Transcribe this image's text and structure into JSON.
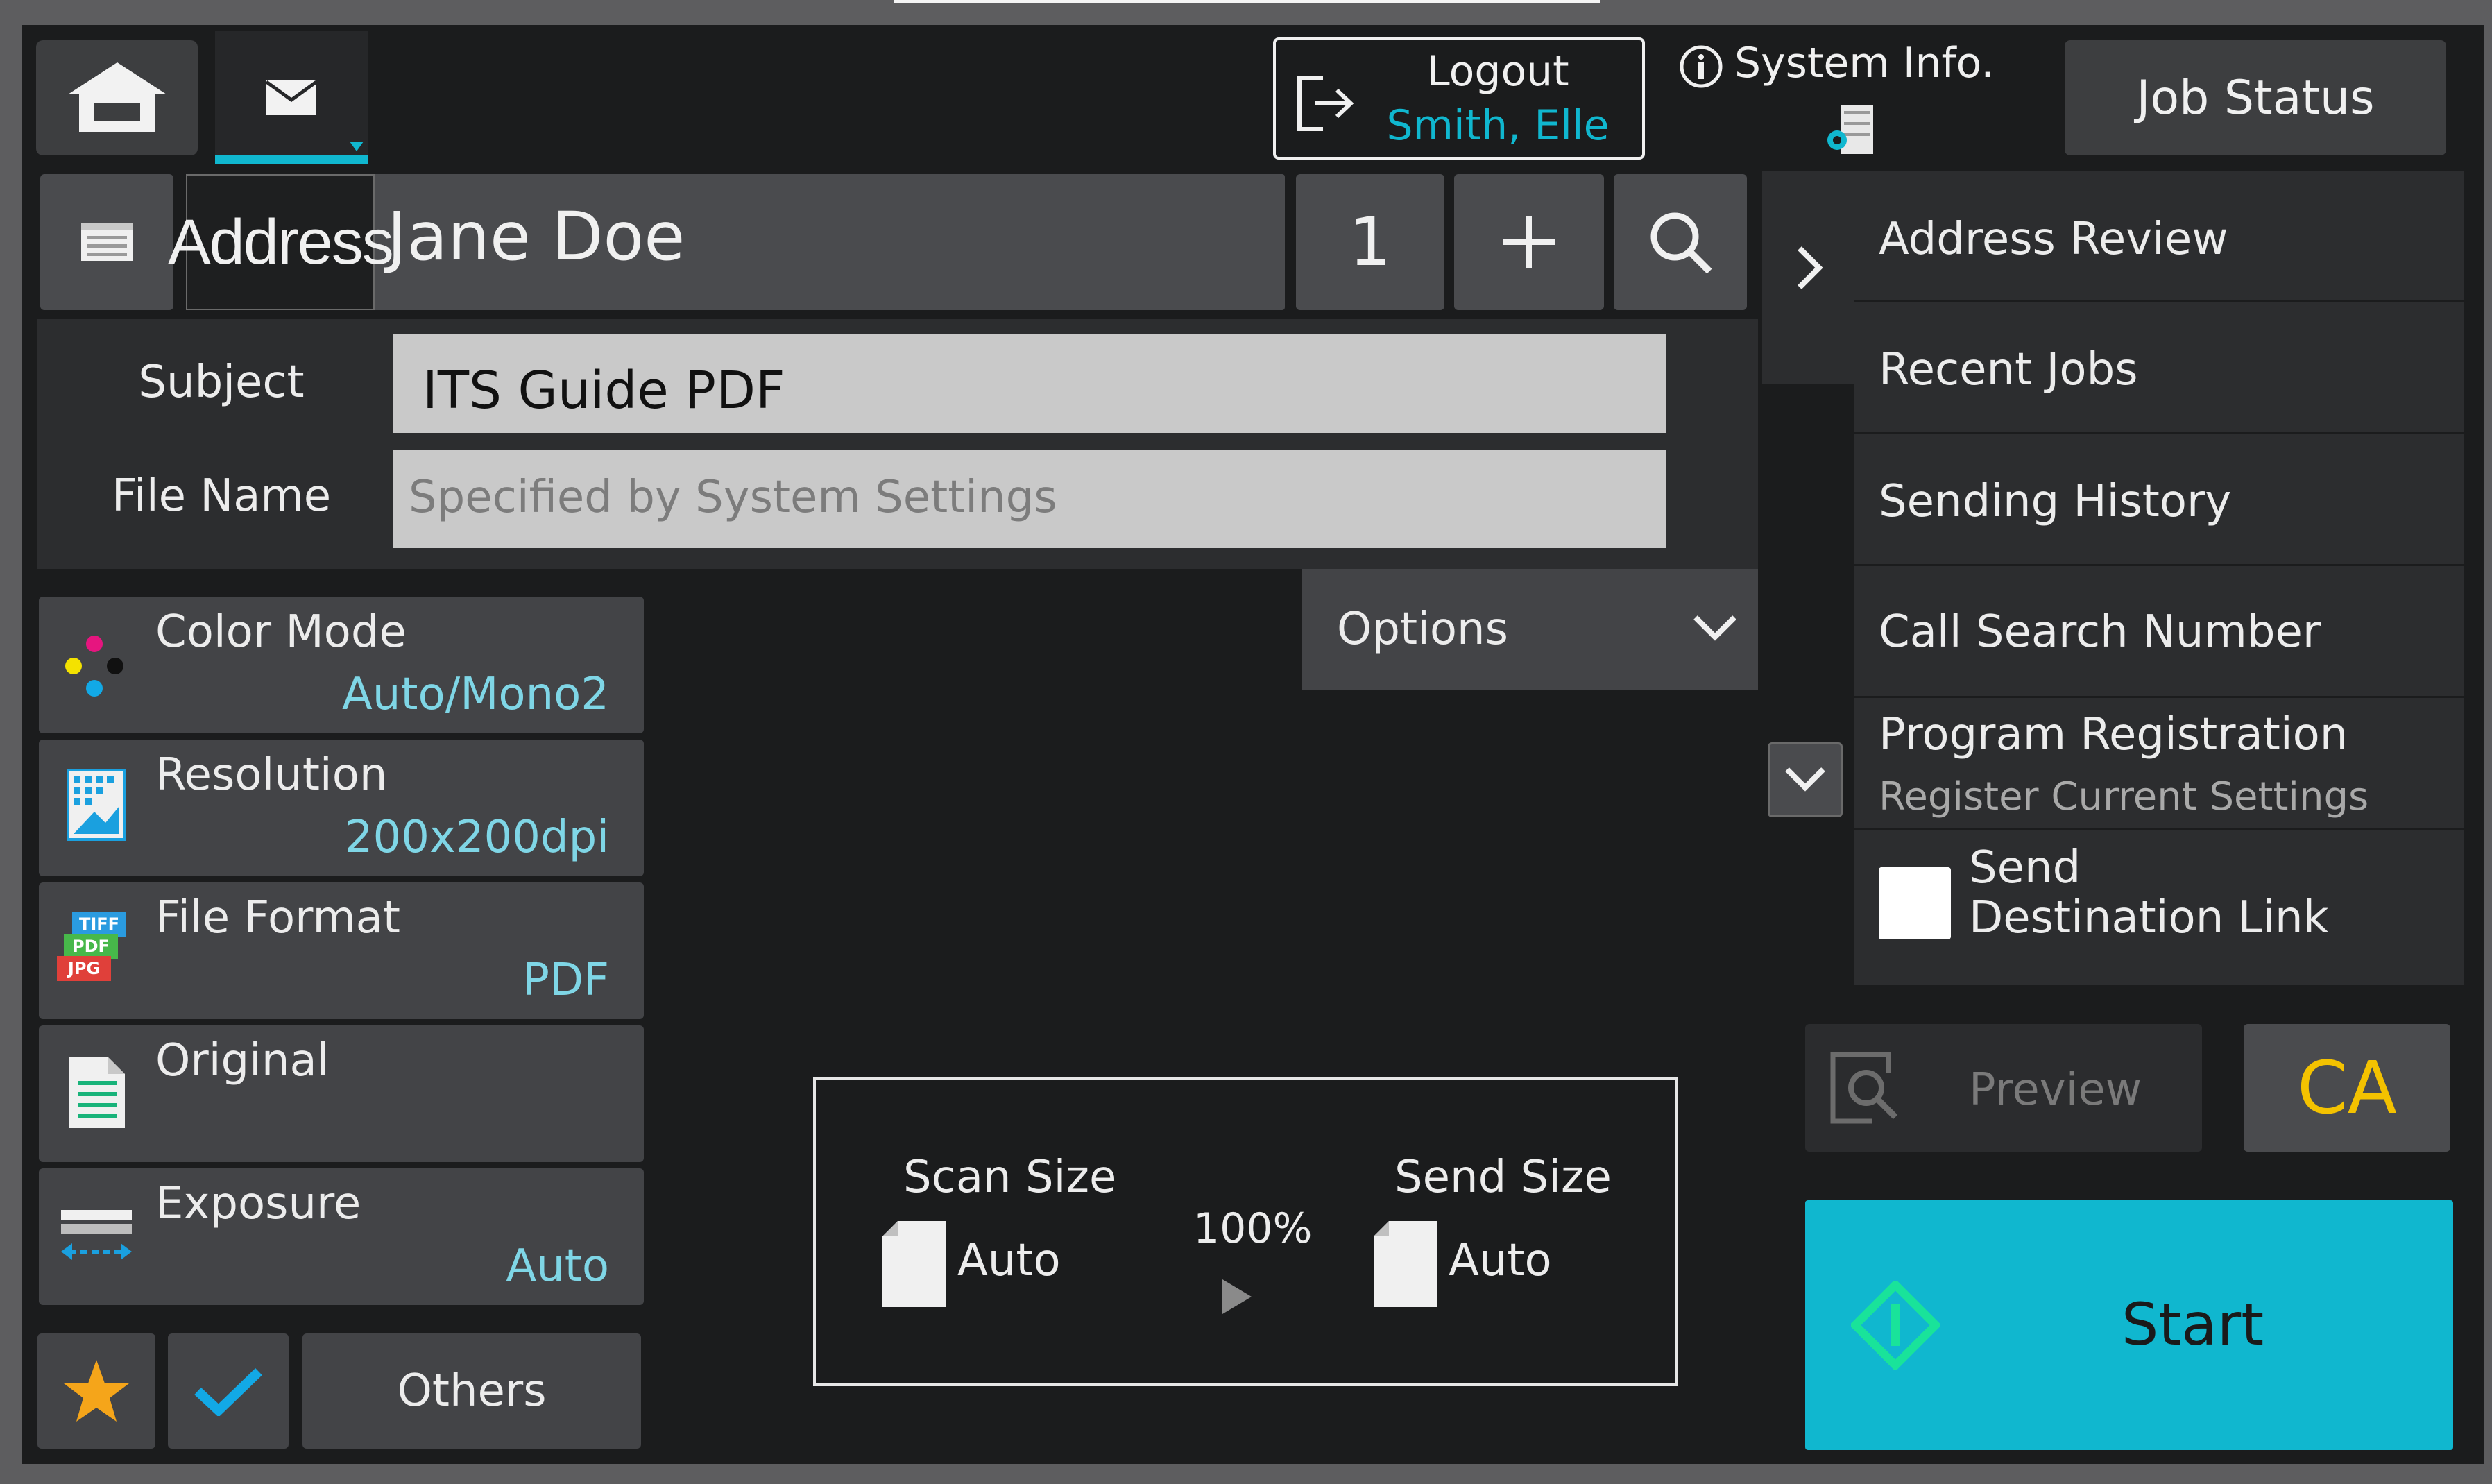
{
  "header": {
    "logout_label": "Logout",
    "user_name": "Smith, Elle",
    "system_info_label": "System Info.",
    "job_status_label": "Job Status"
  },
  "address_bar": {
    "address_label": "Address",
    "recipient": "Jane Doe",
    "recipient_count": "1",
    "add_icon": "plus-icon",
    "search_icon": "search-icon"
  },
  "form": {
    "subject_label": "Subject",
    "subject_value": "ITS Guide PDF",
    "file_name_label": "File Name",
    "file_name_placeholder": "Specified by System Settings",
    "options_label": "Options"
  },
  "settings": [
    {
      "label": "Color Mode",
      "value": "Auto/Mono2",
      "icon": "color-dots-icon"
    },
    {
      "label": "Resolution",
      "value": "200x200dpi",
      "icon": "resolution-icon"
    },
    {
      "label": "File Format",
      "value": "PDF",
      "icon": "file-format-icon",
      "icon_text": [
        "TIFF",
        "PDF",
        "JPG"
      ]
    },
    {
      "label": "Original",
      "value": "",
      "icon": "original-document-icon"
    },
    {
      "label": "Exposure",
      "value": "Auto",
      "icon": "exposure-icon"
    }
  ],
  "bottom_bar": {
    "others_label": "Others"
  },
  "size_panel": {
    "scan_size_label": "Scan Size",
    "scan_size_value": "Auto",
    "ratio": "100%",
    "send_size_label": "Send Size",
    "send_size_value": "Auto"
  },
  "side_menu": {
    "items": [
      {
        "label": "Address Review"
      },
      {
        "label": "Recent Jobs"
      },
      {
        "label": "Sending History"
      },
      {
        "label": "Call Search Number"
      },
      {
        "label": "Program Registration",
        "sub": "Register Current Settings"
      }
    ],
    "checkbox_label_line1": "Send",
    "checkbox_label_line2": "Destination Link",
    "checkbox_checked": false
  },
  "actions": {
    "preview_label": "Preview",
    "ca_label": "CA",
    "start_label": "Start"
  },
  "colors": {
    "accent_cyan": "#10b7cf",
    "start_green": "#19e39a",
    "ca_yellow": "#f4c200",
    "value_cyan": "#7fd6e6"
  }
}
